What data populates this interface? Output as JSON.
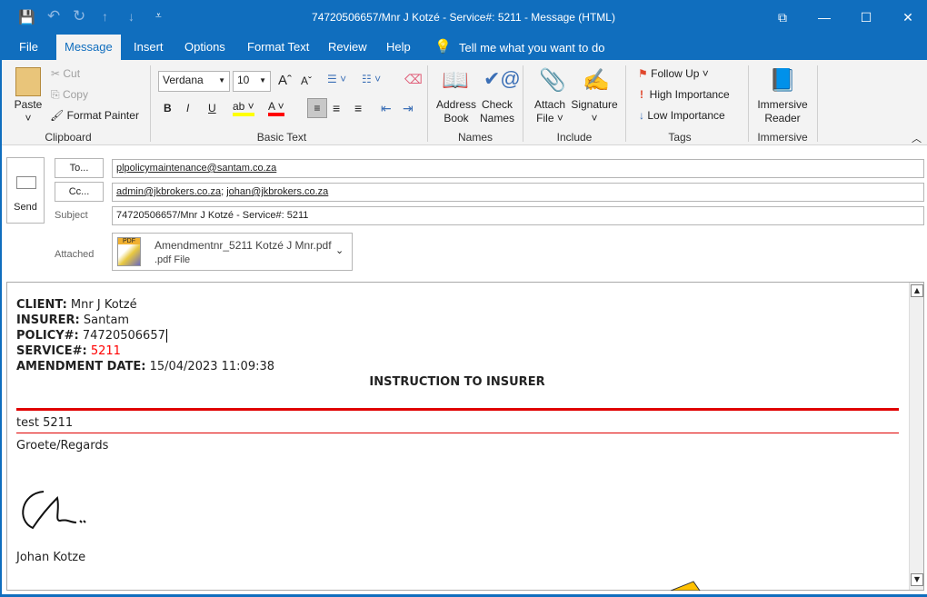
{
  "window": {
    "title": "74720506657/Mnr J Kotzé - Service#: 5211 - Message (HTML)",
    "controls": {
      "restore": "⧉",
      "minimize": "—",
      "maximize": "☐",
      "close": "✕"
    }
  },
  "qat": {
    "save": "💾",
    "undo": "↶",
    "redo": "↻",
    "up": "↑",
    "down": "↓",
    "customize": "⩡"
  },
  "tabs": [
    "File",
    "Message",
    "Insert",
    "Options",
    "Format Text",
    "Review",
    "Help"
  ],
  "tell_me": "Tell me what you want to do",
  "ribbon": {
    "clipboard": {
      "label": "Clipboard",
      "paste": "Paste",
      "cut": "Cut",
      "copy": "Copy",
      "format_painter": "Format Painter"
    },
    "basic_text": {
      "label": "Basic Text",
      "font": "Verdana",
      "size": "10",
      "bold": "B",
      "italic": "I",
      "underline": "U"
    },
    "names": {
      "label": "Names",
      "address_book": [
        "Address",
        "Book"
      ],
      "check_names": [
        "Check",
        "Names"
      ]
    },
    "include": {
      "label": "Include",
      "attach_file": [
        "Attach",
        "File ˅"
      ],
      "signature": [
        "Signature",
        "˅"
      ]
    },
    "tags": {
      "label": "Tags",
      "follow_up": "Follow Up ˅",
      "high": "High Importance",
      "low": "Low Importance"
    },
    "immersive": {
      "label": "Immersive",
      "reader": [
        "Immersive",
        "Reader"
      ]
    }
  },
  "compose": {
    "send": "Send",
    "to_button": "To...",
    "cc_button": "Cc...",
    "subject_label": "Subject",
    "attached_label": "Attached",
    "to": "plpolicymaintenance@santam.co.za",
    "cc": [
      "admin@jkbrokers.co.za",
      "johan@jkbrokers.co.za"
    ],
    "subject": "74720506657/Mnr J Kotzé - Service#: 5211",
    "attachment": {
      "name": "Amendmentnr_5211 Kotzé J Mnr.pdf",
      "type": ".pdf File",
      "icon_text": "PDF"
    }
  },
  "body": {
    "fields": [
      {
        "label": "CLIENT:",
        "value": "Mnr J Kotzé"
      },
      {
        "label": "INSURER:",
        "value": "Santam"
      },
      {
        "label": "POLICY#:",
        "value": "74720506657"
      },
      {
        "label": "SERVICE#:",
        "value": "5211"
      },
      {
        "label": "AMENDMENT DATE:",
        "value": "15/04/2023 11:09:38"
      }
    ],
    "heading": "INSTRUCTION TO INSURER",
    "text": "test 5211",
    "regards": "Groete/Regards",
    "signer": "Johan Kotze"
  },
  "colors": {
    "accent": "#106ebe",
    "service_red": "#ff0000",
    "rule_red": "#e00000"
  }
}
